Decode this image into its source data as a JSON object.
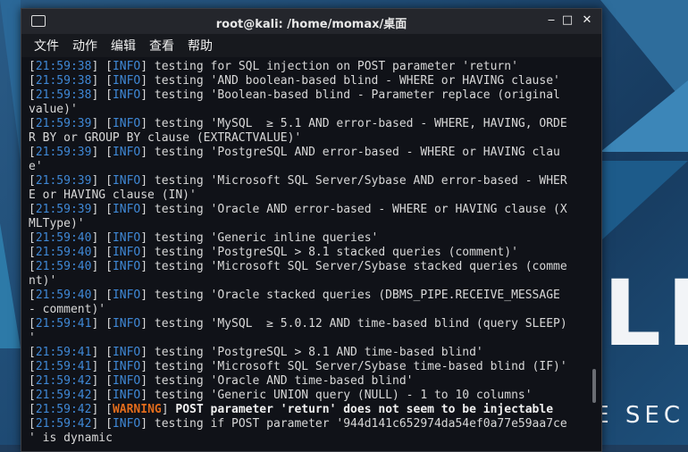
{
  "window": {
    "title": "root@kali: /home/momax/桌面",
    "minimize": "‒",
    "maximize": "□",
    "close": "✕"
  },
  "menu": [
    "文件",
    "动作",
    "编辑",
    "查看",
    "帮助"
  ],
  "wallpaper": {
    "brand": "KALI",
    "tagline": "NSIVE SEC"
  },
  "lines": [
    {
      "ts": "21:59:38",
      "tag": "INFO",
      "msg": " testing for SQL injection on POST parameter 'return'"
    },
    {
      "ts": "21:59:38",
      "tag": "INFO",
      "msg": " testing 'AND boolean-based blind - WHERE or HAVING clause'"
    },
    {
      "ts": "21:59:38",
      "tag": "INFO",
      "msg": " testing 'Boolean-based blind - Parameter replace (original"
    },
    {
      "ts": "",
      "tag": "",
      "msg": "value)'"
    },
    {
      "ts": "21:59:39",
      "tag": "INFO",
      "msg": " testing 'MySQL  ≥ 5.1 AND error-based - WHERE, HAVING, ORDE"
    },
    {
      "ts": "",
      "tag": "",
      "msg": "R BY or GROUP BY clause (EXTRACTVALUE)'"
    },
    {
      "ts": "21:59:39",
      "tag": "INFO",
      "msg": " testing 'PostgreSQL AND error-based - WHERE or HAVING clau"
    },
    {
      "ts": "",
      "tag": "",
      "msg": "e'"
    },
    {
      "ts": "21:59:39",
      "tag": "INFO",
      "msg": " testing 'Microsoft SQL Server/Sybase AND error-based - WHER"
    },
    {
      "ts": "",
      "tag": "",
      "msg": "E or HAVING clause (IN)'"
    },
    {
      "ts": "21:59:39",
      "tag": "INFO",
      "msg": " testing 'Oracle AND error-based - WHERE or HAVING clause (X"
    },
    {
      "ts": "",
      "tag": "",
      "msg": "MLType)'"
    },
    {
      "ts": "21:59:40",
      "tag": "INFO",
      "msg": " testing 'Generic inline queries'"
    },
    {
      "ts": "21:59:40",
      "tag": "INFO",
      "msg": " testing 'PostgreSQL > 8.1 stacked queries (comment)'"
    },
    {
      "ts": "21:59:40",
      "tag": "INFO",
      "msg": " testing 'Microsoft SQL Server/Sybase stacked queries (comme"
    },
    {
      "ts": "",
      "tag": "",
      "msg": "nt)'"
    },
    {
      "ts": "21:59:40",
      "tag": "INFO",
      "msg": " testing 'Oracle stacked queries (DBMS_PIPE.RECEIVE_MESSAGE"
    },
    {
      "ts": "",
      "tag": "",
      "msg": "- comment)'"
    },
    {
      "ts": "21:59:41",
      "tag": "INFO",
      "msg": " testing 'MySQL  ≥ 5.0.12 AND time-based blind (query SLEEP)"
    },
    {
      "ts": "",
      "tag": "",
      "msg": "'"
    },
    {
      "ts": "21:59:41",
      "tag": "INFO",
      "msg": " testing 'PostgreSQL > 8.1 AND time-based blind'"
    },
    {
      "ts": "21:59:41",
      "tag": "INFO",
      "msg": " testing 'Microsoft SQL Server/Sybase time-based blind (IF)'"
    },
    {
      "ts": "21:59:42",
      "tag": "INFO",
      "msg": " testing 'Oracle AND time-based blind'"
    },
    {
      "ts": "21:59:42",
      "tag": "INFO",
      "msg": " testing 'Generic UNION query (NULL) - 1 to 10 columns'"
    },
    {
      "ts": "21:59:42",
      "tag": "WARNING",
      "msg": " POST parameter 'return' does not seem to be injectable"
    },
    {
      "ts": "21:59:42",
      "tag": "INFO",
      "msg": " testing if POST parameter '944d141c652974da54ef0a77e59aa7ce"
    },
    {
      "ts": "",
      "tag": "",
      "msg": "' is dynamic"
    }
  ]
}
